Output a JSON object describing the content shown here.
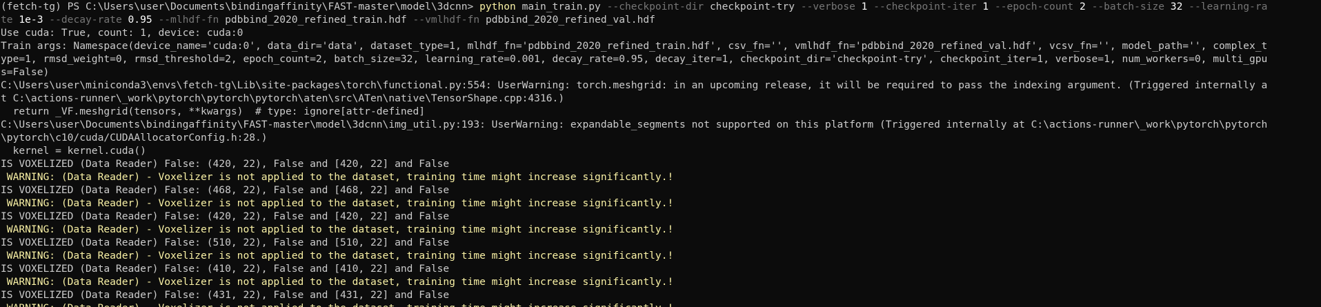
{
  "colors": {
    "background": "#0c0c0c",
    "text": "#cccccc",
    "warning": "#f9f1a5",
    "command": "#f9f1a5",
    "flag": "#767676"
  },
  "command": {
    "prompt": "(fetch-tg) PS C:\\Users\\user\\Documents\\bindingaffinity\\FAST-master\\model\\3dcnn> ",
    "exe": "python",
    "script": " main_train.py ",
    "f1": "--checkpoint-dir",
    "a1": " checkpoint-try ",
    "f2": "--verbose",
    "a2": " 1 ",
    "f3": "--checkpoint-iter",
    "a3": " 1 ",
    "f4": "--epoch-count",
    "a4": " 2 ",
    "f5": "--batch-size",
    "a5": " 32 ",
    "f6a": "--learning-ra",
    "f6b": "te",
    "a6": " 1e-3 ",
    "f7": "--decay-rate",
    "a7": " 0.95 ",
    "f8": "--mlhdf-fn",
    "a8": " pdbbind_2020_refined_train.hdf ",
    "f9": "--vmlhdf-fn",
    "a9": " pdbbind_2020_refined_val.hdf"
  },
  "output": {
    "cuda": "Use cuda: True, count: 1, device: cuda:0",
    "args1": "Train args: Namespace(device_name='cuda:0', data_dir='data', dataset_type=1, mlhdf_fn='pdbbind_2020_refined_train.hdf', csv_fn='', vmlhdf_fn='pdbbind_2020_refined_val.hdf', vcsv_fn='', model_path='', complex_t",
    "args2": "ype=1, rmsd_weight=0, rmsd_threshold=2, epoch_count=2, batch_size=32, learning_rate=0.001, decay_rate=0.95, decay_iter=1, checkpoint_dir='checkpoint-try', checkpoint_iter=1, verbose=1, num_workers=0, multi_gpu",
    "args3": "s=False)",
    "uw1a": "C:\\Users\\user\\miniconda3\\envs\\fetch-tg\\Lib\\site-packages\\torch\\functional.py:554: UserWarning: torch.meshgrid: in an upcoming release, it will be required to pass the indexing argument. (Triggered internally a",
    "uw1b": "t C:\\actions-runner\\_work\\pytorch\\pytorch\\pytorch\\aten\\src\\ATen\\native\\TensorShape.cpp:4316.)",
    "uw1c": "  return _VF.meshgrid(tensors, **kwargs)  # type: ignore[attr-defined]",
    "uw2a": "C:\\Users\\user\\Documents\\bindingaffinity\\FAST-master\\model\\3dcnn\\img_util.py:193: UserWarning: expandable_segments not supported on this platform (Triggered internally at C:\\actions-runner\\_work\\pytorch\\pytorch",
    "uw2b": "\\pytorch\\c10/cuda/CUDAAllocatorConfig.h:28.)",
    "uw2c": "  kernel = kernel.cuda()",
    "vox1": "IS VOXELIZED (Data Reader) False: (420, 22), False and [420, 22] and False",
    "warn1": " WARNING: (Data Reader) - Voxelizer is not applied to the dataset, training time might increase significantly.!",
    "vox2": "IS VOXELIZED (Data Reader) False: (468, 22), False and [468, 22] and False",
    "warn2": " WARNING: (Data Reader) - Voxelizer is not applied to the dataset, training time might increase significantly.!",
    "vox3": "IS VOXELIZED (Data Reader) False: (420, 22), False and [420, 22] and False",
    "warn3": " WARNING: (Data Reader) - Voxelizer is not applied to the dataset, training time might increase significantly.!",
    "vox4": "IS VOXELIZED (Data Reader) False: (510, 22), False and [510, 22] and False",
    "warn4": " WARNING: (Data Reader) - Voxelizer is not applied to the dataset, training time might increase significantly.!",
    "vox5": "IS VOXELIZED (Data Reader) False: (410, 22), False and [410, 22] and False",
    "warn5": " WARNING: (Data Reader) - Voxelizer is not applied to the dataset, training time might increase significantly.!",
    "vox6": "IS VOXELIZED (Data Reader) False: (431, 22), False and [431, 22] and False",
    "warn6": " WARNING: (Data Reader) - Voxelizer is not applied to the dataset, training time might increase significantly.!"
  }
}
